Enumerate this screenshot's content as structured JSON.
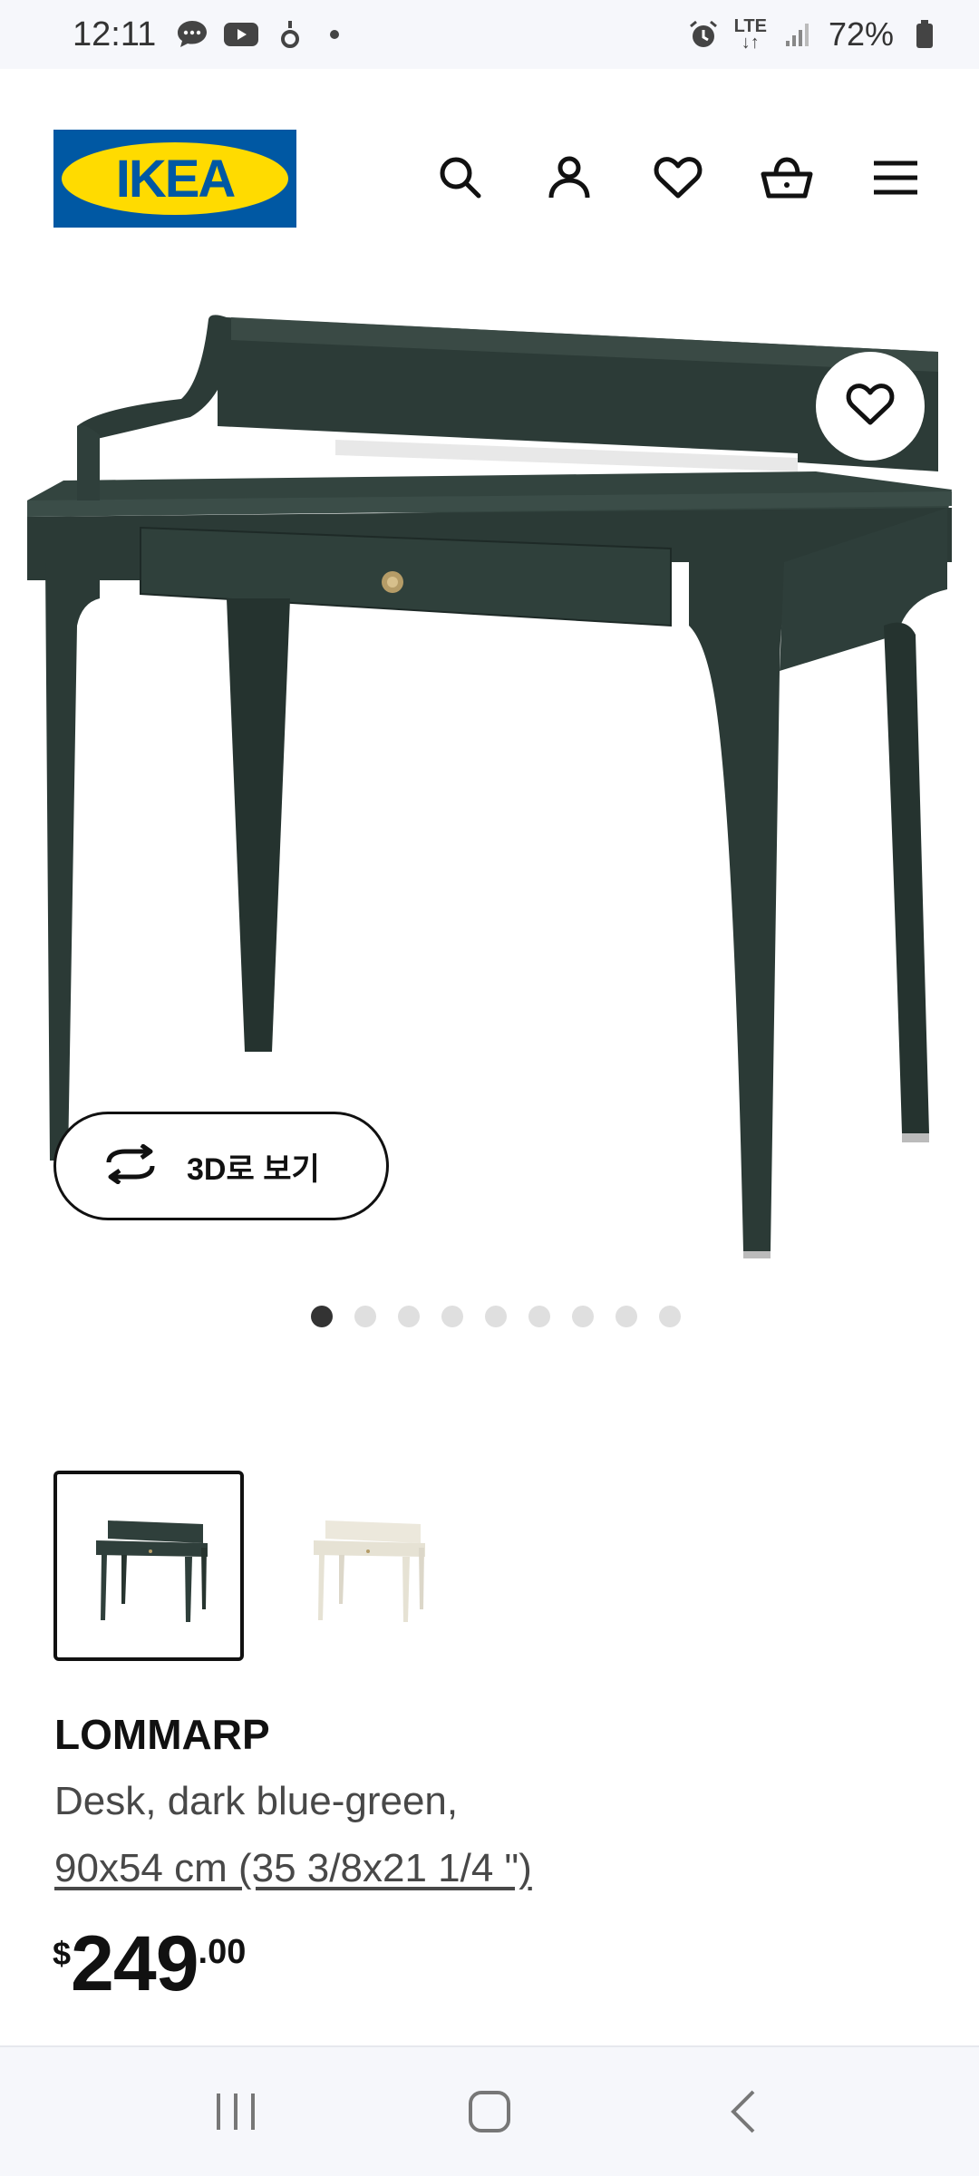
{
  "status_bar": {
    "time": "12:11",
    "battery": "72%",
    "network": "LTE",
    "icons": [
      "chat-bubble-icon",
      "youtube-icon",
      "app-notification-icon",
      "dot-icon",
      "alarm-icon",
      "lte-icon",
      "signal-icon",
      "battery-icon"
    ]
  },
  "header": {
    "logo_text": "IKEA",
    "icons": [
      "search-icon",
      "account-icon",
      "wishlist-heart-icon",
      "shopping-basket-icon",
      "menu-icon"
    ]
  },
  "gallery": {
    "view_3d_label": "3D로 보기",
    "image_count": 9,
    "active_index": 0
  },
  "variants": [
    {
      "color": "dark blue-green",
      "selected": true
    },
    {
      "color": "white",
      "selected": false
    }
  ],
  "product": {
    "name": "LOMMARP",
    "description": "Desk, dark blue-green,",
    "size": "90x54 cm (35 3/8x21 1/4 \")",
    "price_currency": "$",
    "price_int": "249",
    "price_dec": ".00"
  },
  "colors": {
    "ikea_blue": "#0058a3",
    "ikea_yellow": "#ffdb00",
    "desk_green": "#2f3f3b",
    "desk_white": "#efece2"
  }
}
